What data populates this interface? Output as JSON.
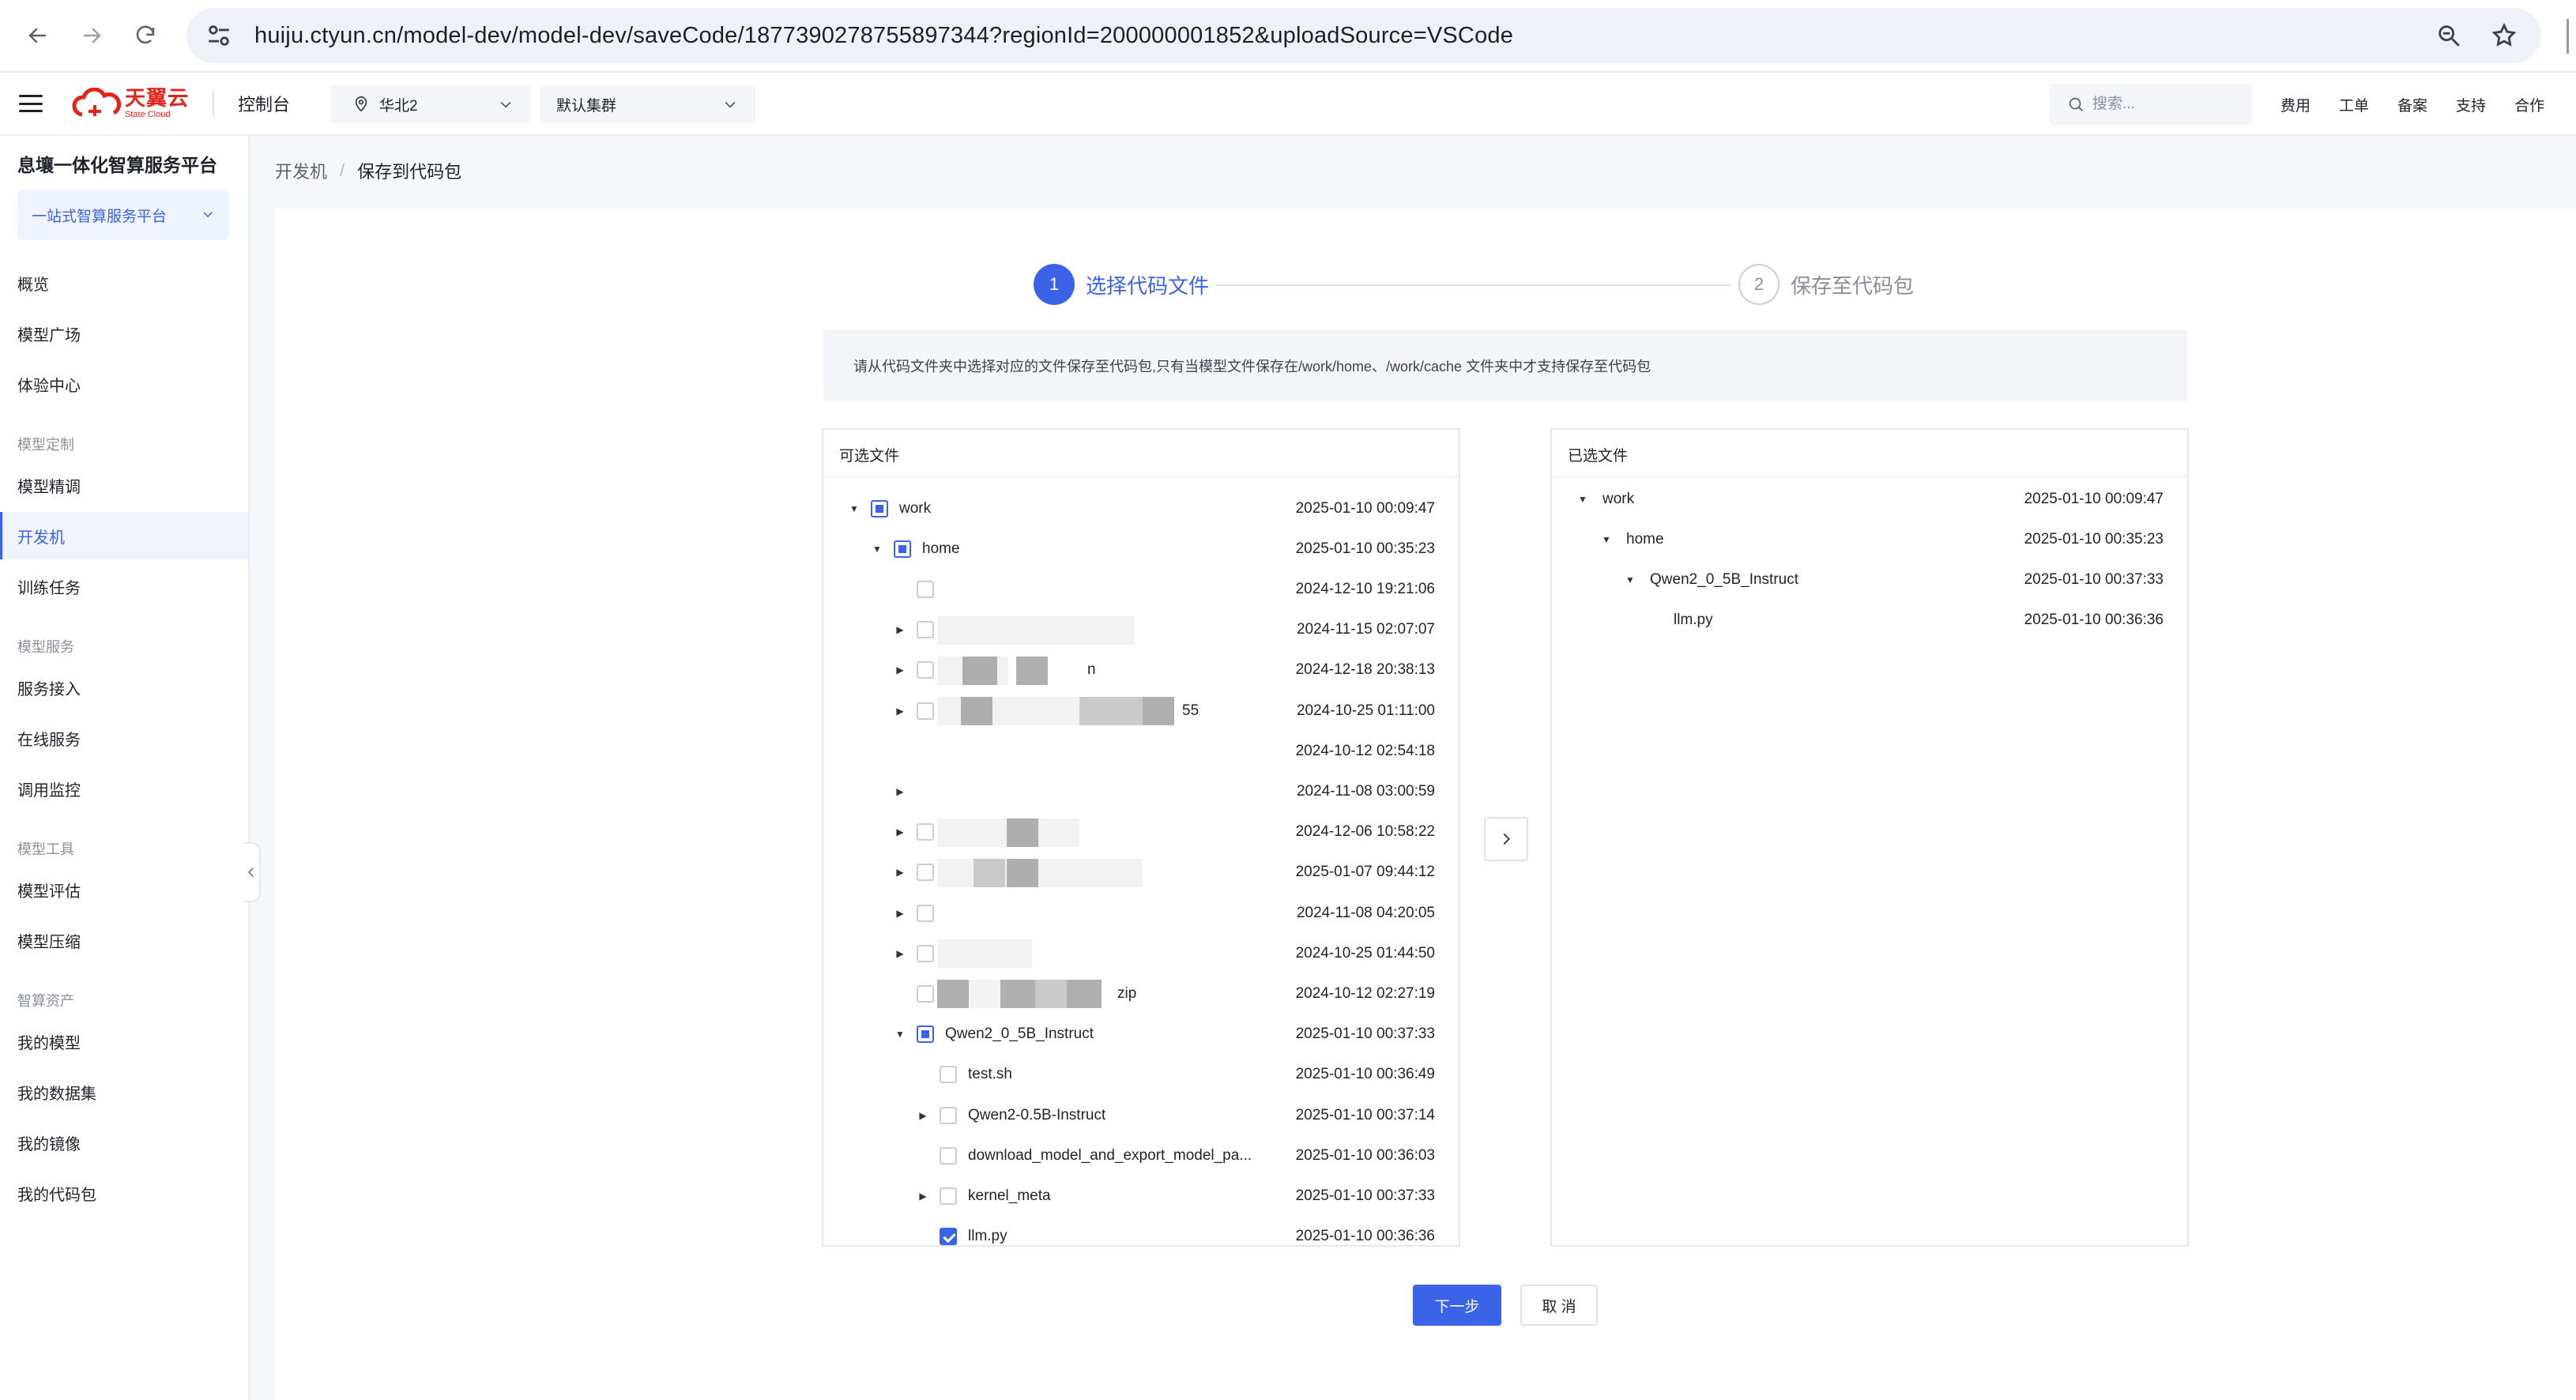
{
  "browser": {
    "url_host": "huiju.ctyun.cn",
    "url_path": "/model-dev/model-dev/saveCode/1877390278755897344?regionId=200000001852&uploadSource=VSCode"
  },
  "header": {
    "logo_cn": "天翼云",
    "logo_en": "State Cloud",
    "console_label": "控制台",
    "region": "华北2",
    "cluster": "默认集群",
    "search_placeholder": "搜索...",
    "links": [
      "费用",
      "工单",
      "备案",
      "支持",
      "合作"
    ]
  },
  "sidebar": {
    "title": "息壤一体化智算服务平台",
    "platform": "一站式智算服务平台",
    "items_top": [
      "概览",
      "模型广场",
      "体验中心"
    ],
    "groups": [
      {
        "label": "模型定制",
        "items": [
          "模型精调",
          "开发机",
          "训练任务"
        ]
      },
      {
        "label": "模型服务",
        "items": [
          "服务接入",
          "在线服务",
          "调用监控"
        ]
      },
      {
        "label": "模型工具",
        "items": [
          "模型评估",
          "模型压缩"
        ]
      },
      {
        "label": "智算资产",
        "items": [
          "我的模型",
          "我的数据集",
          "我的镜像",
          "我的代码包"
        ]
      }
    ],
    "active": "开发机"
  },
  "breadcrumb": {
    "parent": "开发机",
    "sep": "/",
    "current": "保存到代码包"
  },
  "steps": [
    {
      "num": "1",
      "label": "选择代码文件"
    },
    {
      "num": "2",
      "label": "保存至代码包"
    }
  ],
  "notice": "请从代码文件夹中选择对应的文件保存至代码包,只有当模型文件保存在/work/home、/work/cache 文件夹中才支持保存至代码包",
  "left_panel": {
    "title": "可选文件",
    "rows": [
      {
        "name": "work",
        "time": "2025-01-10 00:09:47"
      },
      {
        "name": "home",
        "time": "2025-01-10 00:35:23"
      },
      {
        "name": "",
        "time": "2024-12-10 19:21:06"
      },
      {
        "name": "",
        "time": "2024-11-15 02:07:07"
      },
      {
        "name": "n",
        "time": "2024-12-18 20:38:13"
      },
      {
        "name": "55",
        "time": "2024-10-25 01:11:00"
      },
      {
        "name": "",
        "time": "2024-10-12 02:54:18"
      },
      {
        "name": "",
        "time": "2024-11-08 03:00:59"
      },
      {
        "name": "",
        "time": "2024-12-06 10:58:22"
      },
      {
        "name": "",
        "time": "2025-01-07 09:44:12"
      },
      {
        "name": "",
        "time": "2024-11-08 04:20:05"
      },
      {
        "name": "",
        "time": "2024-10-25 01:44:50"
      },
      {
        "name": "zip",
        "time": "2024-10-12 02:27:19"
      },
      {
        "name": "Qwen2_0_5B_Instruct",
        "time": "2025-01-10 00:37:33"
      },
      {
        "name": "test.sh",
        "time": "2025-01-10 00:36:49"
      },
      {
        "name": "Qwen2-0.5B-Instruct",
        "time": "2025-01-10 00:37:14"
      },
      {
        "name": "download_model_and_export_model_pa...",
        "time": "2025-01-10 00:36:03"
      },
      {
        "name": "kernel_meta",
        "time": "2025-01-10 00:37:33"
      },
      {
        "name": "llm.py",
        "time": "2025-01-10 00:36:36"
      }
    ]
  },
  "right_panel": {
    "title": "已选文件",
    "rows": [
      {
        "name": "work",
        "time": "2025-01-10 00:09:47"
      },
      {
        "name": "home",
        "time": "2025-01-10 00:35:23"
      },
      {
        "name": "Qwen2_0_5B_Instruct",
        "time": "2025-01-10 00:37:33"
      },
      {
        "name": "llm.py",
        "time": "2025-01-10 00:36:36"
      }
    ]
  },
  "actions": {
    "next": "下一步",
    "cancel": "取 消"
  },
  "colors": {
    "accent": "#3a63e8",
    "brand": "#e1251b"
  }
}
